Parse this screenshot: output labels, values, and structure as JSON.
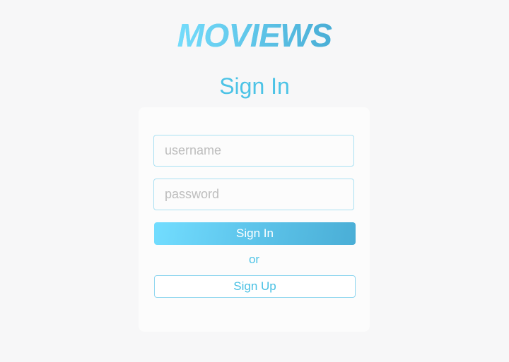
{
  "app": {
    "logo_text": "MOVIEWS"
  },
  "page": {
    "title": "Sign In"
  },
  "form": {
    "username_placeholder": "username",
    "username_value": "",
    "password_placeholder": "password",
    "password_value": "",
    "signin_label": "Sign In",
    "or_label": "or",
    "signup_label": "Sign Up"
  },
  "colors": {
    "background": "#f7f7f8",
    "card": "#fcfcfc",
    "accent": "#4cc3e6",
    "gradient_start": "#72ddff",
    "gradient_end": "#4aaed6",
    "field_border": "#a9e0f2",
    "placeholder": "#bdbdbd"
  }
}
